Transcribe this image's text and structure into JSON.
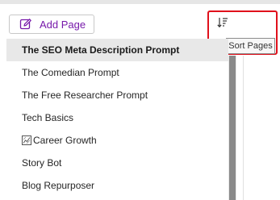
{
  "toolbar": {
    "add_page_label": "Add Page",
    "add_page_icon": "compose-icon",
    "sort_icon": "sort-icon",
    "sort_tooltip": "Sort Pages"
  },
  "colors": {
    "accent": "#7719aa",
    "highlight": "#e0101b",
    "selected_bg": "#e8e8e8"
  },
  "pages": [
    {
      "label": "The SEO Meta Description Prompt",
      "selected": true
    },
    {
      "label": "The Comedian Prompt",
      "selected": false
    },
    {
      "label": "The Free Researcher Prompt",
      "selected": false
    },
    {
      "label": "Tech Basics",
      "selected": false
    },
    {
      "label": "Career Growth",
      "selected": false,
      "icon": "chart-icon"
    },
    {
      "label": "Story Bot",
      "selected": false
    },
    {
      "label": "Blog Repurposer",
      "selected": false
    }
  ]
}
